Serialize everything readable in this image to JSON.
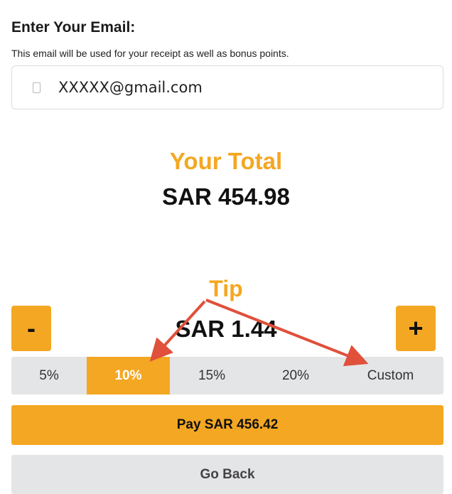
{
  "email": {
    "heading": "Enter Your Email:",
    "hint": "This email will be used for your receipt as well as bonus points.",
    "value": "XXXXX@gmail.com",
    "icon": "mail-icon"
  },
  "total": {
    "label": "Your Total",
    "amount": "SAR 454.98"
  },
  "tip": {
    "label": "Tip",
    "amount": "SAR 1.44",
    "minus_label": "-",
    "plus_label": "+",
    "selected": "10%",
    "options": [
      "5%",
      "10%",
      "15%",
      "20%",
      "Custom"
    ]
  },
  "actions": {
    "pay_label": "Pay SAR 456.42",
    "back_label": "Go Back"
  },
  "colors": {
    "accent": "#f4a722",
    "neutral": "#e4e5e7",
    "annotation": "#e0503a"
  }
}
